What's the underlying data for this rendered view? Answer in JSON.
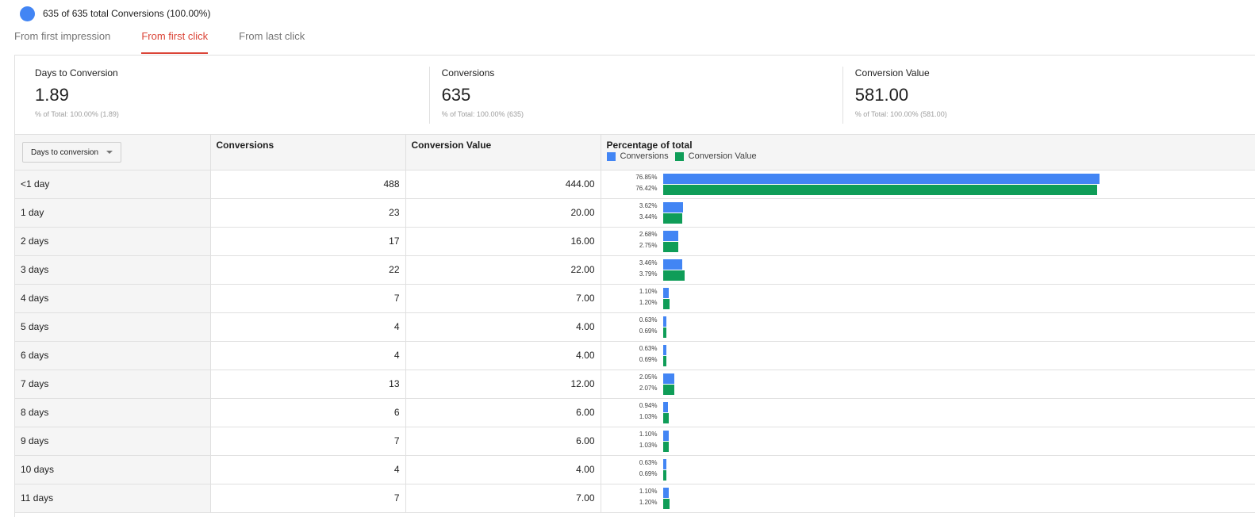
{
  "segment": {
    "label": "635 of 635 total Conversions (100.00%)",
    "color": "#4285f4"
  },
  "tabs": [
    {
      "label": "From first impression",
      "active": false
    },
    {
      "label": "From first click",
      "active": true
    },
    {
      "label": "From last click",
      "active": false
    }
  ],
  "scorecards": [
    {
      "label": "Days to Conversion",
      "value": "1.89",
      "sub": "% of Total: 100.00% (1.89)"
    },
    {
      "label": "Conversions",
      "value": "635",
      "sub": "% of Total: 100.00% (635)"
    },
    {
      "label": "Conversion Value",
      "value": "581.00",
      "sub": "% of Total: 100.00% (581.00)"
    }
  ],
  "table": {
    "dimension_selector": "Days to conversion",
    "columns": {
      "conversions": "Conversions",
      "value": "Conversion Value",
      "percentage": "Percentage of total"
    },
    "legend": {
      "conversions": "Conversions",
      "value": "Conversion Value"
    },
    "colors": {
      "conversions": "#4285f4",
      "value": "#0f9d58"
    },
    "rows": [
      {
        "dim": "<1 day",
        "conv": "488",
        "val": "444.00",
        "conv_pct": "76.85%",
        "val_pct": "76.42%"
      },
      {
        "dim": "1 day",
        "conv": "23",
        "val": "20.00",
        "conv_pct": "3.62%",
        "val_pct": "3.44%"
      },
      {
        "dim": "2 days",
        "conv": "17",
        "val": "16.00",
        "conv_pct": "2.68%",
        "val_pct": "2.75%"
      },
      {
        "dim": "3 days",
        "conv": "22",
        "val": "22.00",
        "conv_pct": "3.46%",
        "val_pct": "3.79%"
      },
      {
        "dim": "4 days",
        "conv": "7",
        "val": "7.00",
        "conv_pct": "1.10%",
        "val_pct": "1.20%"
      },
      {
        "dim": "5 days",
        "conv": "4",
        "val": "4.00",
        "conv_pct": "0.63%",
        "val_pct": "0.69%"
      },
      {
        "dim": "6 days",
        "conv": "4",
        "val": "4.00",
        "conv_pct": "0.63%",
        "val_pct": "0.69%"
      },
      {
        "dim": "7 days",
        "conv": "13",
        "val": "12.00",
        "conv_pct": "2.05%",
        "val_pct": "2.07%"
      },
      {
        "dim": "8 days",
        "conv": "6",
        "val": "6.00",
        "conv_pct": "0.94%",
        "val_pct": "1.03%"
      },
      {
        "dim": "9 days",
        "conv": "7",
        "val": "6.00",
        "conv_pct": "1.10%",
        "val_pct": "1.03%"
      },
      {
        "dim": "10 days",
        "conv": "4",
        "val": "4.00",
        "conv_pct": "0.63%",
        "val_pct": "0.69%"
      },
      {
        "dim": "11 days",
        "conv": "7",
        "val": "7.00",
        "conv_pct": "1.10%",
        "val_pct": "1.20%"
      }
    ]
  }
}
